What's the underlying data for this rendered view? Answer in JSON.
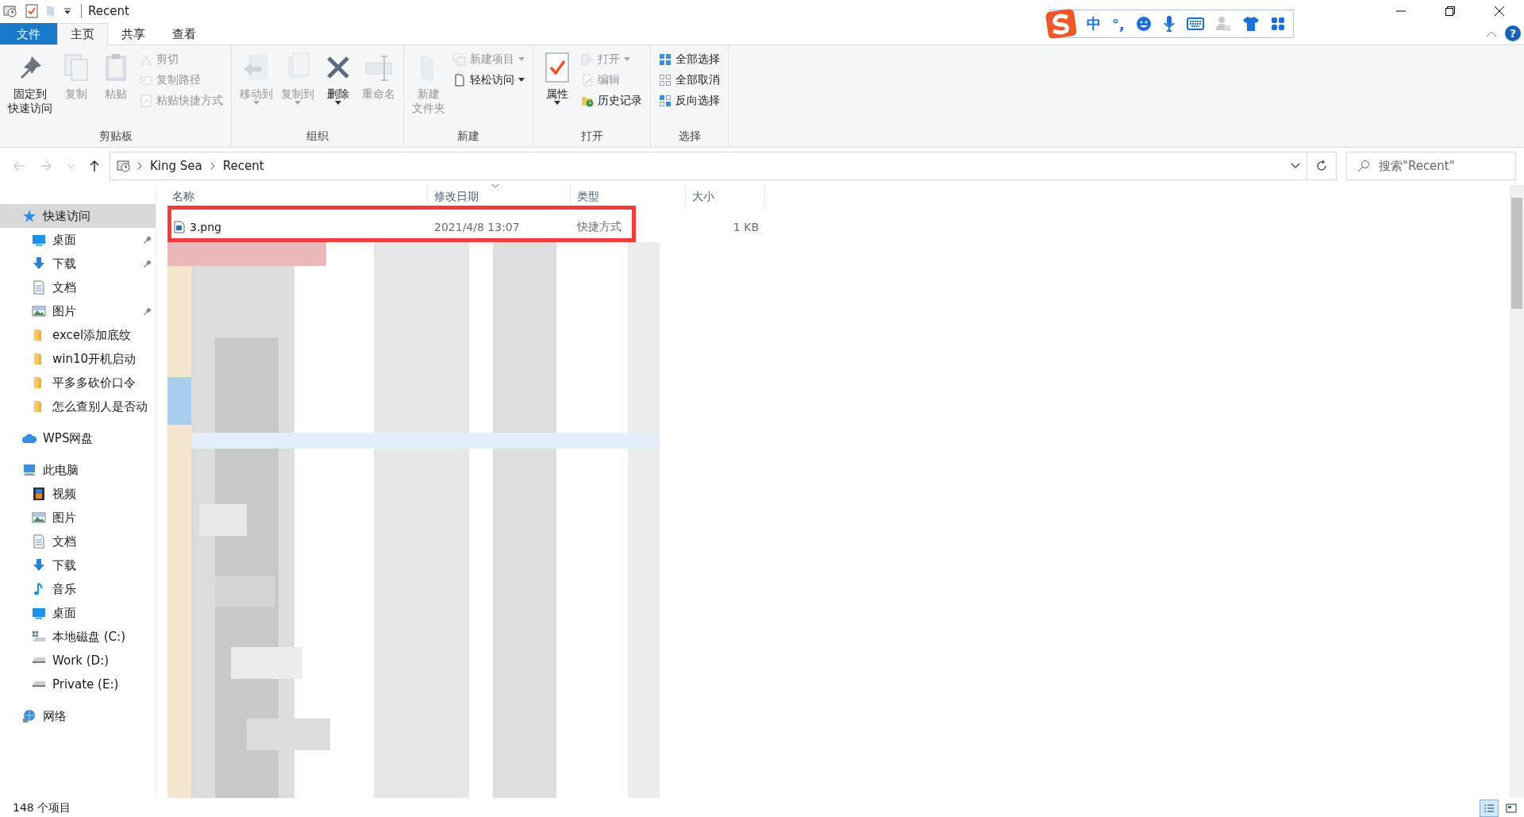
{
  "window": {
    "title": "Recent",
    "help": "?"
  },
  "ime_bar": {
    "items": [
      "中",
      "°,"
    ]
  },
  "menu_tabs": [
    {
      "label": "文件",
      "kind": "file",
      "selected": false
    },
    {
      "label": "主页",
      "kind": "tab",
      "selected": true
    },
    {
      "label": "共享",
      "kind": "tab",
      "selected": false
    },
    {
      "label": "查看",
      "kind": "tab",
      "selected": false
    }
  ],
  "ribbon": {
    "groups": [
      {
        "label": "剪贴板",
        "large": [
          {
            "lines": [
              "固定到",
              "快速访问"
            ],
            "kind": "pin",
            "disabled": false,
            "menu": false
          },
          {
            "lines": [
              "复制"
            ],
            "kind": "copy",
            "disabled": true,
            "menu": false
          },
          {
            "lines": [
              "粘贴"
            ],
            "kind": "paste",
            "disabled": true,
            "menu": false
          }
        ],
        "small": [
          {
            "label": "剪切",
            "kind": "scissors",
            "disabled": true,
            "menu": false
          },
          {
            "label": "复制路径",
            "kind": "path",
            "disabled": true,
            "menu": false
          },
          {
            "label": "粘贴快捷方式",
            "kind": "shortcut",
            "disabled": true,
            "menu": false
          }
        ]
      },
      {
        "label": "组织",
        "large": [
          {
            "lines": [
              "移动到"
            ],
            "kind": "move",
            "disabled": true,
            "menu": true
          },
          {
            "lines": [
              "复制到"
            ],
            "kind": "copyto",
            "disabled": true,
            "menu": true
          },
          {
            "lines": [
              "删除"
            ],
            "kind": "delete",
            "disabled": false,
            "menu": true
          },
          {
            "lines": [
              "重命名"
            ],
            "kind": "rename",
            "disabled": true,
            "menu": false
          }
        ]
      },
      {
        "label": "新建",
        "large": [
          {
            "lines": [
              "新建",
              "文件夹"
            ],
            "kind": "newfolder",
            "disabled": true,
            "menu": false
          }
        ],
        "small": [
          {
            "label": "新建项目",
            "kind": "newitem",
            "disabled": true,
            "menu": true
          },
          {
            "label": "轻松访问",
            "kind": "easy",
            "disabled": false,
            "menu": true
          }
        ]
      },
      {
        "label": "打开",
        "large": [
          {
            "lines": [
              "属性"
            ],
            "kind": "properties",
            "disabled": false,
            "menu": true
          }
        ],
        "small": [
          {
            "label": "打开",
            "kind": "open",
            "disabled": true,
            "menu": true
          },
          {
            "label": "编辑",
            "kind": "edit",
            "disabled": true,
            "menu": false
          },
          {
            "label": "历史记录",
            "kind": "history",
            "disabled": false,
            "menu": false
          }
        ]
      },
      {
        "label": "选择",
        "small": [
          {
            "label": "全部选择",
            "kind": "selectall",
            "disabled": false,
            "menu": false
          },
          {
            "label": "全部取消",
            "kind": "selectnone",
            "disabled": false,
            "menu": false
          },
          {
            "label": "反向选择",
            "kind": "invert",
            "disabled": false,
            "menu": false
          }
        ]
      }
    ]
  },
  "address": {
    "path": [
      "King Sea",
      "Recent"
    ],
    "search_placeholder": "搜索\"Recent\""
  },
  "sidebar": {
    "items": [
      {
        "label": "快速访问",
        "kind": "quick",
        "selected": true,
        "children": [
          {
            "label": "桌面",
            "kind": "desktop",
            "selected": false,
            "pinned": true
          },
          {
            "label": "下载",
            "kind": "download",
            "selected": false,
            "pinned": true
          },
          {
            "label": "文档",
            "kind": "document",
            "selected": false,
            "pinned": false
          },
          {
            "label": "图片",
            "kind": "picture",
            "selected": false,
            "pinned": true
          },
          {
            "label": "excel添加底纹",
            "kind": "folder",
            "selected": false,
            "pinned": false
          },
          {
            "label": "win10开机启动",
            "kind": "folder",
            "selected": false,
            "pinned": false
          },
          {
            "label": "平多多砍价口令",
            "kind": "folder",
            "selected": false,
            "pinned": false
          },
          {
            "label": "怎么查别人是否动",
            "kind": "folder",
            "selected": false,
            "pinned": false
          }
        ]
      },
      {
        "label": "WPS网盘",
        "kind": "cloud",
        "selected": false
      },
      {
        "label": "此电脑",
        "kind": "pc",
        "selected": false,
        "children": [
          {
            "label": "视频",
            "kind": "video",
            "selected": false
          },
          {
            "label": "图片",
            "kind": "picture",
            "selected": false
          },
          {
            "label": "文档",
            "kind": "document",
            "selected": false
          },
          {
            "label": "下载",
            "kind": "download",
            "selected": false
          },
          {
            "label": "音乐",
            "kind": "music",
            "selected": false
          },
          {
            "label": "桌面",
            "kind": "desktop",
            "selected": false
          },
          {
            "label": "本地磁盘 (C:)",
            "kind": "windrive",
            "selected": false
          },
          {
            "label": "Work (D:)",
            "kind": "drive",
            "selected": false
          },
          {
            "label": "Private (E:)",
            "kind": "drive",
            "selected": false
          }
        ]
      },
      {
        "label": "网络",
        "kind": "network",
        "selected": false
      }
    ]
  },
  "table": {
    "columns": [
      {
        "label": "名称",
        "sorted": false
      },
      {
        "label": "修改日期",
        "sorted": true
      },
      {
        "label": "类型",
        "sorted": false
      },
      {
        "label": "大小",
        "sorted": false
      }
    ],
    "rows": [
      {
        "name": "3.png",
        "date": "2021/4/8 13:07",
        "type": "快捷方式",
        "size": "1 KB",
        "highlighted": true
      }
    ]
  },
  "status_bar": {
    "count": "148 个项目",
    "views": [
      {
        "kind": "details",
        "selected": true
      },
      {
        "kind": "tiles",
        "selected": false
      }
    ]
  }
}
